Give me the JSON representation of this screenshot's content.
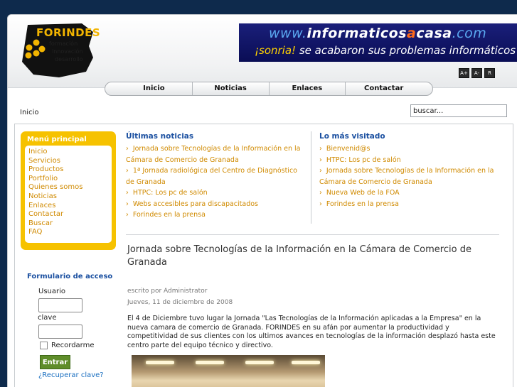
{
  "logo": {
    "title": "FORINDES",
    "lines": [
      "formación",
      "innovación",
      "desarrollo"
    ]
  },
  "banner": {
    "url_parts": [
      "www.",
      "informaticos",
      "a",
      "casa",
      ".com"
    ],
    "slogan_parts": [
      "¡sonria!",
      " se acabaron sus problemas informáticos"
    ]
  },
  "font_controls": [
    "A+",
    "A-",
    "R"
  ],
  "nav": [
    "Inicio",
    "Noticias",
    "Enlaces",
    "Contactar"
  ],
  "breadcrumb": "Inicio",
  "search": {
    "value": "buscar..."
  },
  "main_menu": {
    "title": "Menú principal",
    "items": [
      "Inicio",
      "Servicios",
      "Productos",
      "Portfolio",
      "Quienes somos",
      "Noticias",
      "Enlaces",
      "Contactar",
      "Buscar",
      "FAQ"
    ]
  },
  "login": {
    "title": "Formulario de acceso",
    "user_label": "Usuario",
    "pass_label": "clave",
    "remember_label": "Recordarme",
    "submit_label": "Entrar",
    "forgot_label": "¿Recuperar clave?"
  },
  "latest_news": {
    "title": "Últimas noticias",
    "items": [
      "Jornada sobre Tecnologías de la Información en la Cámara de Comercio de Granada",
      "1ª Jornada radiológica del Centro de Diagnóstico de Granada",
      "HTPC: Los pc de salón",
      "Webs accesibles para discapacitados",
      "Forindes en la prensa"
    ]
  },
  "most_visited": {
    "title": "Lo más visitado",
    "items": [
      "Bienvenid@s",
      "HTPC: Los pc de salón",
      "Jornada sobre Tecnologías de la Información en la Cámara de Comercio de Granada",
      "Nueva Web de la FOA",
      "Forindes en la prensa"
    ]
  },
  "article": {
    "title": "Jornada sobre Tecnologías de la Información en la Cámara de Comercio de Granada",
    "author": "escrito por Administrator",
    "date": "Jueves, 11 de diciembre de 2008",
    "body": "El 4 de Diciembre tuvo lugar la Jornada \"Las Tecnologías de la Información aplicadas a la Empresa\" en la nueva camara de comercio de Granada. FORINDES en su afán por aumentar la productividad y competitividad de sus clientes con los ultimos avances en tecnologías de la información desplazó hasta este centro parte del equipo técnico y directivo."
  },
  "colors": {
    "background": "#0e2a4c",
    "menu_yellow": "#f6c200",
    "link_orange": "#d08a00",
    "heading_blue": "#1a4fa0",
    "button_green": "#5f8d2a"
  }
}
